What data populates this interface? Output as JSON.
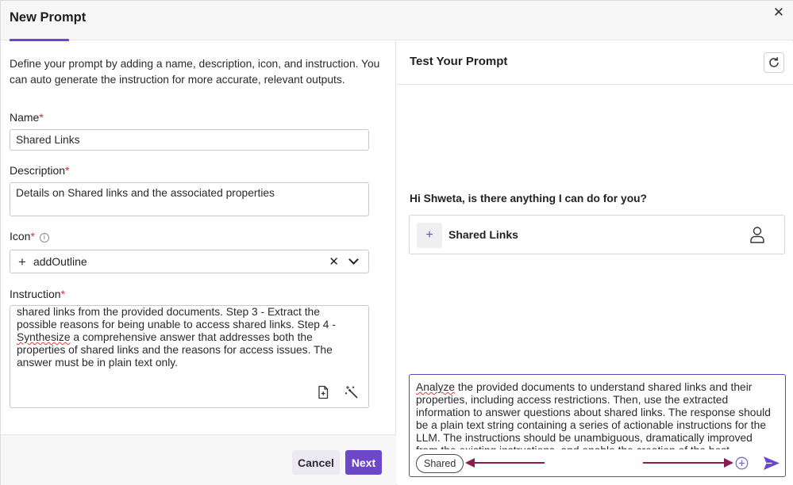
{
  "header": {
    "title": "New Prompt",
    "close_icon": "close-icon"
  },
  "form": {
    "intro": "Define your prompt by adding a name, description, icon, and instruction. You can auto generate the instruction for more accurate, relevant outputs.",
    "name": {
      "label": "Name",
      "required_mark": "*",
      "value": "Shared Links"
    },
    "description": {
      "label": "Description",
      "required_mark": "*",
      "value": "Details on Shared links and the associated properties"
    },
    "icon": {
      "label": "Icon",
      "required_mark": "*",
      "value": "addOutline",
      "info_icon": "info-icon"
    },
    "instruction": {
      "label": "Instruction",
      "required_mark": "*",
      "line1": "shared links from the provided documents. Step 3 - Extract the",
      "line2": "possible reasons for being unable to access shared links. Step 4 -",
      "line3_squiggle": "Synthesize",
      "line3_rest": " a comprehensive answer that addresses both the",
      "line4": "properties of shared links and the reasons for access issues. The",
      "line5": "answer must be in plain text only."
    },
    "buttons": {
      "cancel": "Cancel",
      "next": "Next"
    }
  },
  "test_panel": {
    "title": "Test Your Prompt",
    "greeting": "Hi Shweta, is there anything I can do for you?",
    "card": {
      "plus": "+",
      "label": "Shared Links"
    },
    "chat": {
      "squiggle_word": "Analyze",
      "text_rest": " the provided documents to understand shared links and their properties, including access restrictions. Then, use the extracted information to answer questions about shared links. The response should be a plain text string containing a series of actionable instructions for the LLM. The instructions should be unambiguous, dramatically improved from the existing instructions, and enable the creation of the best",
      "chip": "Shared"
    }
  },
  "colors": {
    "accent": "#6c47c9",
    "annotation_arrow": "#8b1d4f",
    "required": "#d0342c"
  }
}
